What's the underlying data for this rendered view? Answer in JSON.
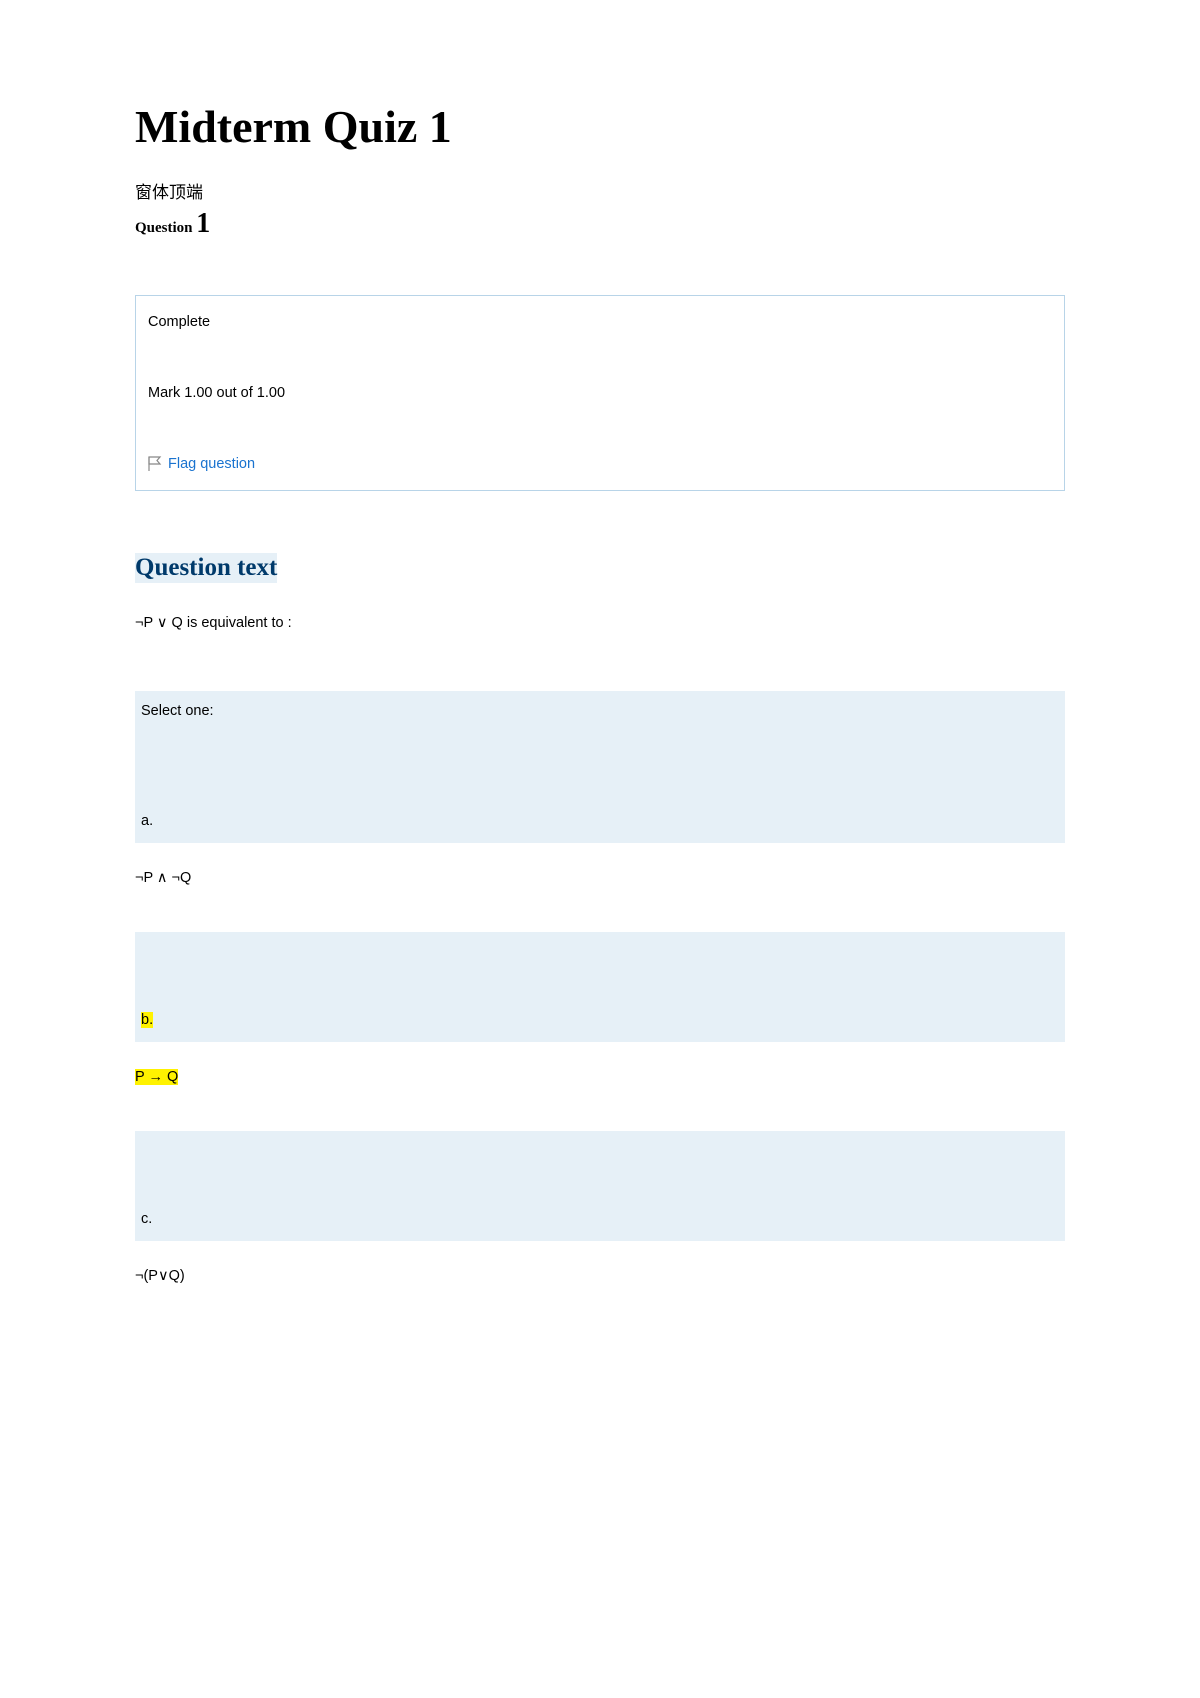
{
  "title": "Midterm Quiz 1",
  "formTop": "窗体顶端",
  "questionLabel": "Question",
  "questionNumber": "1",
  "status": {
    "complete": "Complete",
    "mark": "Mark 1.00 out of 1.00",
    "flagLabel": "Flag question"
  },
  "questionTextHeading": "Question text",
  "questionPrompt": "¬P ∨ Q is equivalent to :",
  "selectOne": "Select one:",
  "options": {
    "a": {
      "letter": "a.",
      "answer": "¬P ∧ ¬Q"
    },
    "b": {
      "letter": "b.",
      "answer": "P → Q"
    },
    "c": {
      "letter": "c.",
      "answer": "¬(P∨Q)"
    }
  }
}
